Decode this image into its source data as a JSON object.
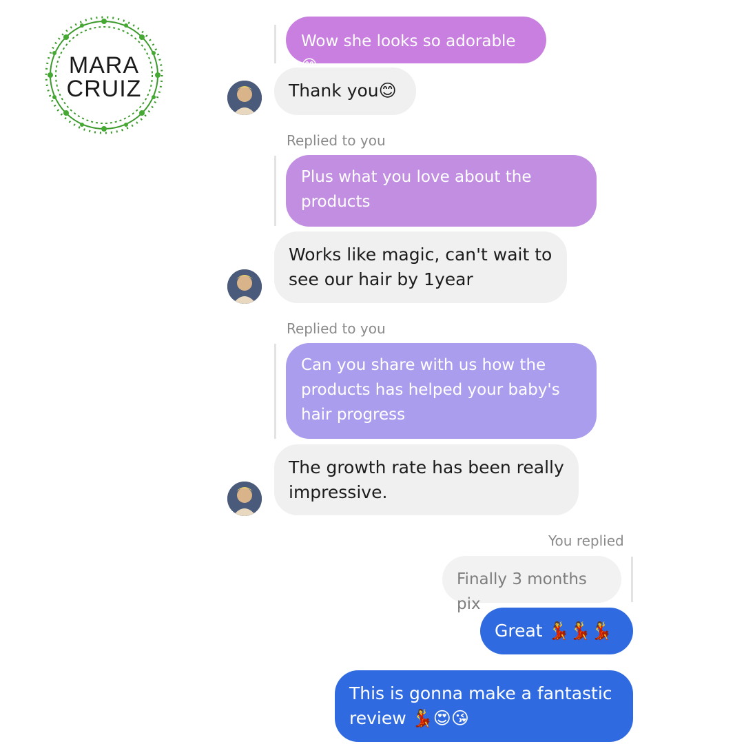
{
  "brand": {
    "line1": "MARA",
    "line2": "CRUIZ",
    "wreath_color": "#3c9a2c"
  },
  "colors": {
    "incoming_bubble": "#f0f0f0",
    "reply_quote_pink": "#c87fe0",
    "reply_quote_purple": "#c18ee2",
    "reply_quote_lavender": "#ab9ded",
    "outgoing_bubble": "#2f6ae0"
  },
  "messages": {
    "quote_top": "Wow she looks so adorable 😊",
    "m1": "Thank you😊",
    "reply_label_1": "Replied to you",
    "quote_2": "Plus what you love about the products",
    "m2": "Works like magic, can't wait to see our hair by 1year",
    "reply_label_2": "Replied to you",
    "quote_3": "Can you share with us how the products has helped your baby's hair progress",
    "m3": "The growth rate has been really impressive.",
    "you_replied_label": "You replied",
    "quote_own": "Finally 3 months pix",
    "out1": "Great 💃💃💃",
    "out2": "This is gonna make a fantastic review 💃😍😘"
  },
  "avatar_icon": "user-avatar-photo"
}
